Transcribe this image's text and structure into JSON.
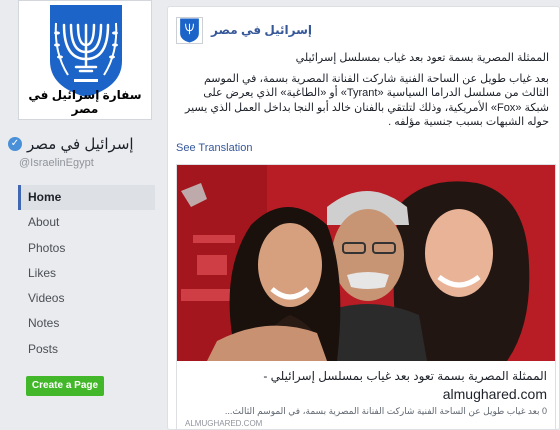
{
  "sidebar": {
    "profile_caption": "سفارة إسرائيل في مصر",
    "page_name": "إسرائيل في مصر",
    "handle": "@IsraelinEgypt",
    "nav": [
      {
        "label": "Home",
        "active": true
      },
      {
        "label": "About"
      },
      {
        "label": "Photos"
      },
      {
        "label": "Likes"
      },
      {
        "label": "Videos"
      },
      {
        "label": "Notes"
      },
      {
        "label": "Posts"
      }
    ],
    "create_page_label": "Create a Page"
  },
  "post": {
    "author": "إسرائيل في مصر",
    "paragraph1": "الممثلة المصرية بسمة تعود بعد غياب بمسلسل إسرائيلي",
    "paragraph2": "بعد غياب طويل عن الساحة الفنية شاركت الفنانة المصرية بسمة، في الموسم الثالث من مسلسل الدراما السياسية «Tyrant» أو «الطاغية» الذي يعرض على شبكة «Fox» الأمريكية، وذلك لتلتقي بالفنان خالد أبو النجا بداخل العمل الذي يسير حوله الشبهات بسبب جنسية مؤلفه .",
    "see_translation": "See Translation",
    "link": {
      "title": "الممثلة المصرية بسمة تعود بعد غياب بمسلسل إسرائيلي -",
      "domain": "almughared.com",
      "description": "0 بعد غياب طويل عن الساحة الفنية شاركت الفنانة المصرية بسمة، في الموسم الثالث...",
      "source": "ALMUGHARED.COM"
    }
  },
  "colors": {
    "link_blue": "#365899",
    "create_green": "#42b72a",
    "emblem_blue": "#1c64c8",
    "verified_blue": "#4a90d9"
  }
}
